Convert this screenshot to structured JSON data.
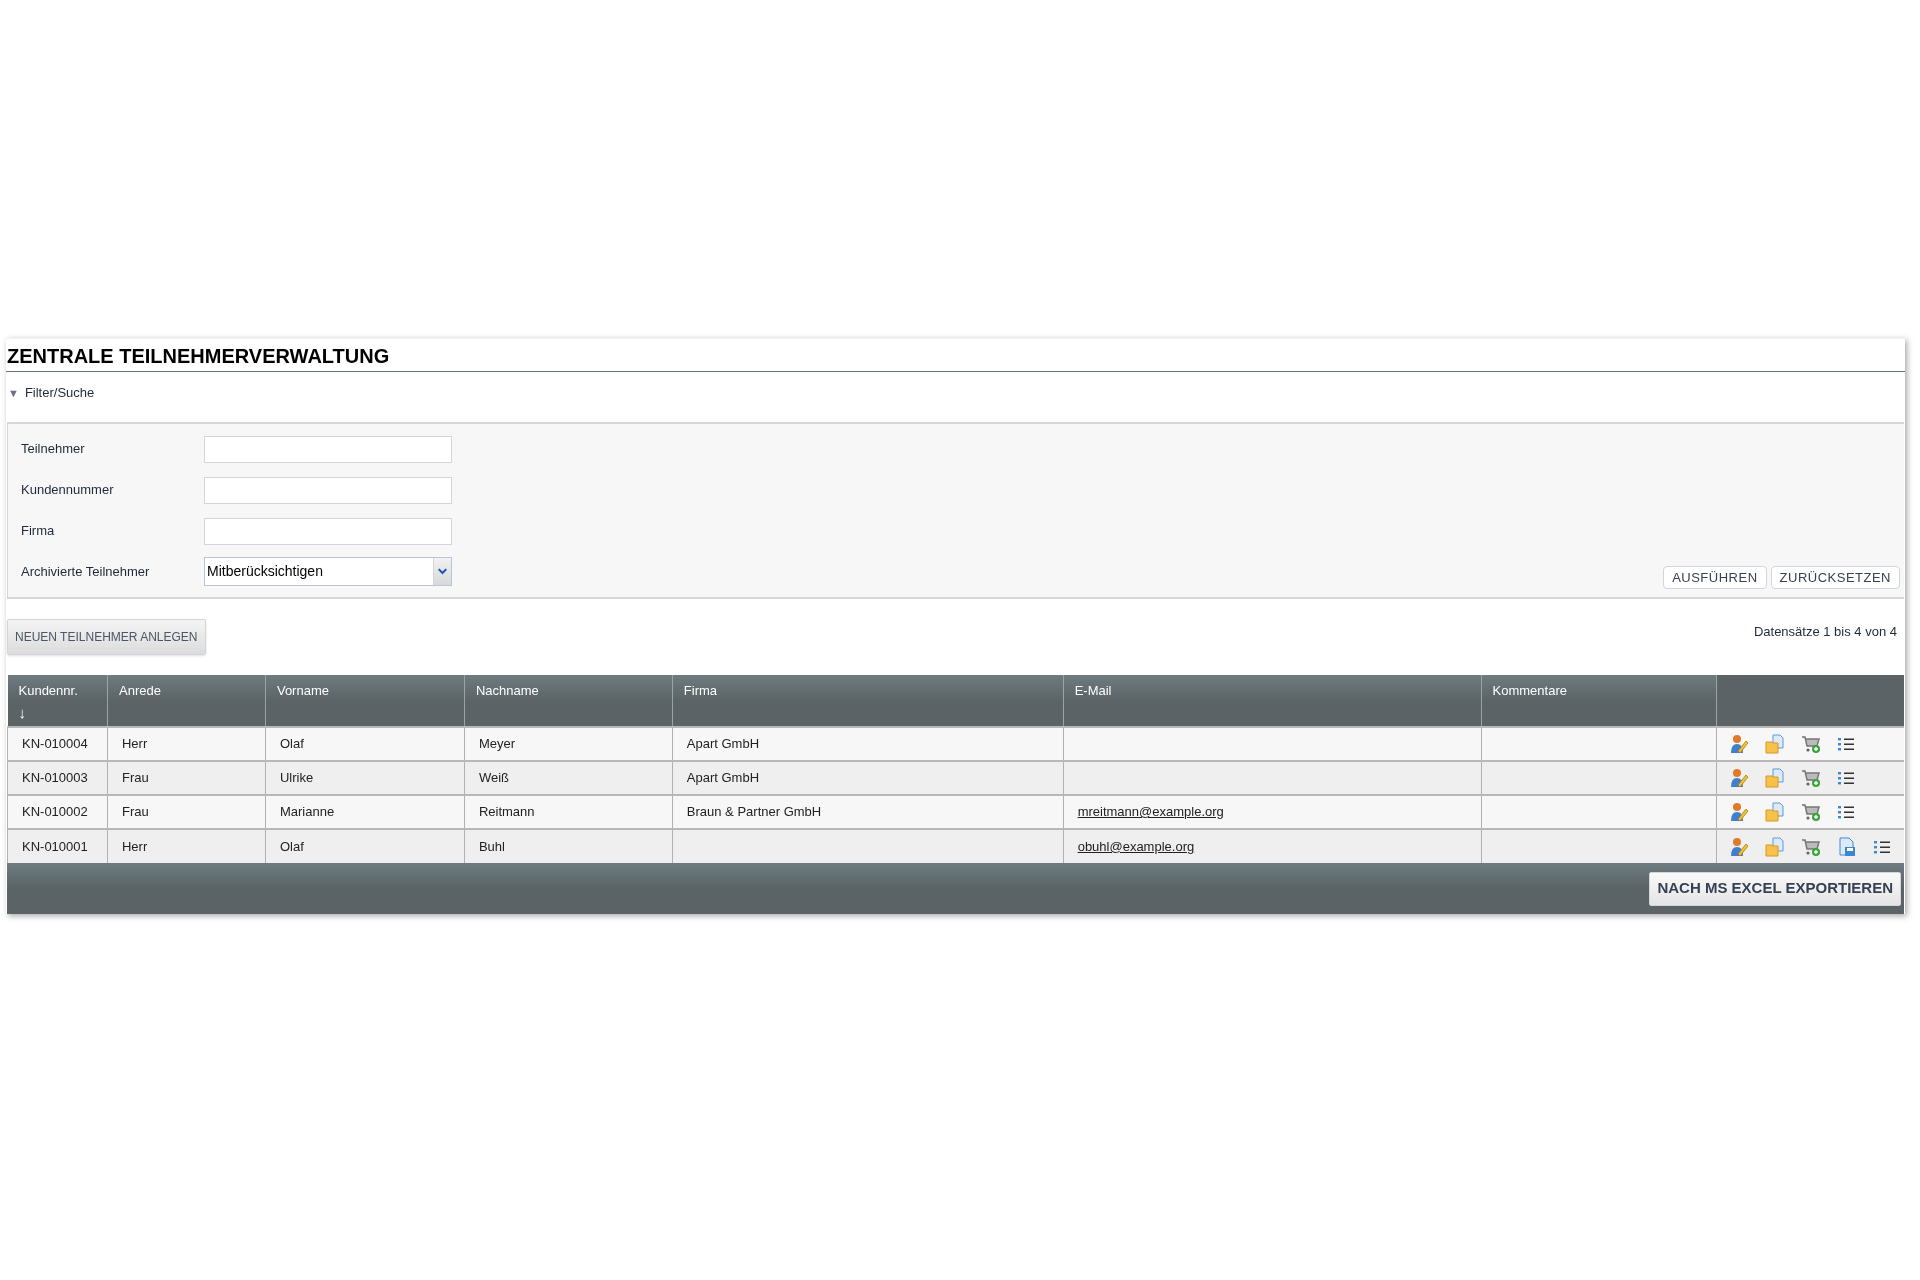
{
  "title": "ZENTRALE TEILNEHMERVERWALTUNG",
  "filter": {
    "toggle": "▼",
    "label": "Filter/Suche",
    "expanded": true,
    "fields": [
      {
        "kind": "text",
        "label": "Teilnehmer"
      },
      {
        "kind": "text",
        "label": "Kundennummer"
      },
      {
        "kind": "text",
        "label": "Firma"
      },
      {
        "kind": "select",
        "label": "Archivierte Teilnehmer",
        "value": "Mitberücksichtigen"
      }
    ],
    "buttons": [
      "AUSFÜHREN",
      "ZURÜCKSETZEN"
    ]
  },
  "new_button": "NEUEN TEILNEHMER ANLEGEN",
  "record_count": "Datensätze 1 bis 4 von 4",
  "table": {
    "columns": [
      {
        "label": "Kundennr.",
        "sort": "↓"
      },
      {
        "label": "Anrede"
      },
      {
        "label": "Vorname"
      },
      {
        "label": "Nachname"
      },
      {
        "label": "Firma"
      },
      {
        "label": "E-Mail"
      },
      {
        "label": "Kommentare"
      },
      {}
    ],
    "rows": [
      {
        "cells": [
          "KN-010004",
          "Herr",
          "Olaf",
          "Meyer",
          "Apart GmbH",
          "",
          ""
        ],
        "actions": [
          {
            "kind": "person"
          },
          {
            "kind": "documents"
          },
          {
            "kind": "cart"
          },
          {
            "kind": "list"
          }
        ]
      },
      {
        "cells": [
          "KN-010003",
          "Frau",
          "Ulrike",
          "Weiß",
          "Apart GmbH",
          "",
          ""
        ],
        "actions": [
          {
            "kind": "person"
          },
          {
            "kind": "documents"
          },
          {
            "kind": "cart"
          },
          {
            "kind": "list"
          }
        ]
      },
      {
        "cells": [
          "KN-010002",
          "Frau",
          "Marianne",
          "Reitmann",
          "Braun & Partner GmbH",
          "mreitmann@example.org",
          ""
        ],
        "actions": [
          {
            "kind": "person"
          },
          {
            "kind": "documents"
          },
          {
            "kind": "cart"
          },
          {
            "kind": "list"
          }
        ]
      },
      {
        "cells": [
          "KN-010001",
          "Herr",
          "Olaf",
          "Buhl",
          "",
          "obuhl@example.org",
          ""
        ],
        "actions": [
          {
            "kind": "person"
          },
          {
            "kind": "documents"
          },
          {
            "kind": "cart"
          },
          {
            "kind": "save"
          },
          {
            "kind": "list"
          }
        ]
      }
    ]
  },
  "export_button": "NACH MS EXCEL EXPORTIEREN"
}
